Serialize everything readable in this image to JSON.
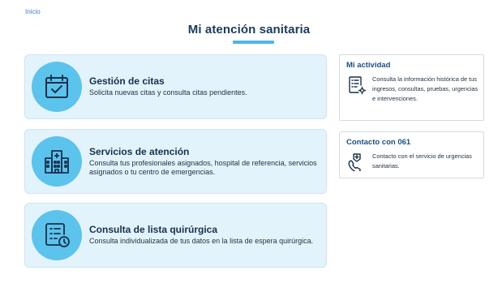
{
  "breadcrumb": {
    "label": "Inicio"
  },
  "page": {
    "title": "Mi atención sanitaria"
  },
  "cards": [
    {
      "title": "Gestión de citas",
      "description": "Solicita nuevas citas y consulta citas pendientes.",
      "icon": "calendar-check-icon"
    },
    {
      "title": "Servicios de atención",
      "description": "Consulta tus profesionales asignados, hospital de referencia, servicios asignados o tu centro de emergencias.",
      "icon": "hospital-building-icon"
    },
    {
      "title": "Consulta de lista quirúrgica",
      "description": "Consulta individualizada de tus datos en la lista de espera quirúrgica.",
      "icon": "checklist-clock-icon"
    }
  ],
  "sidebar": {
    "activity": {
      "title": "Mi actividad",
      "description": "Consulta la información histórica de tus ingresos, consultas, pruebas, urgencias e intervenciones.",
      "icon": "list-settings-icon"
    },
    "contact": {
      "title": "Contacto con 061",
      "description": "Contacto con el servicio de urgencias sanitarias.",
      "icon": "emergency-phone-icon"
    }
  },
  "colors": {
    "accent": "#4cb6e6",
    "icon_circle": "#5cc3ec",
    "card_bg": "#e3f3fc",
    "title": "#1b3a5c",
    "link": "#3a7fc0"
  }
}
